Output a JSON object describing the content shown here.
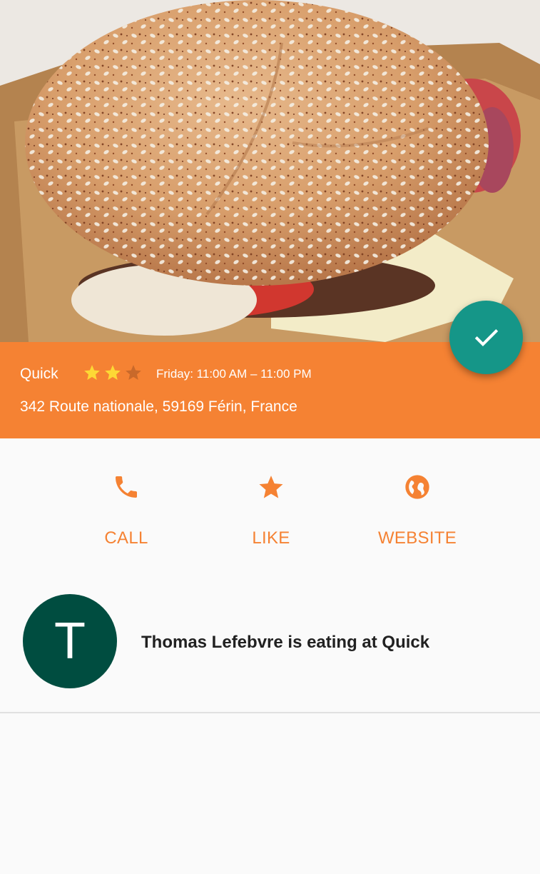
{
  "hero": {
    "image_alt": "Burger photo"
  },
  "place": {
    "name": "Quick",
    "rating": {
      "filled": 2,
      "total": 3
    },
    "hours": "Friday: 11:00 AM – 11:00 PM",
    "address": "342 Route nationale, 59169 Férin, France"
  },
  "actions": [
    {
      "label": "CALL",
      "icon": "phone-icon"
    },
    {
      "label": "LIKE",
      "icon": "star-icon"
    },
    {
      "label": "WEBSITE",
      "icon": "globe-icon"
    }
  ],
  "feed": {
    "avatar_letter": "T",
    "text": "Thomas Lefebvre is eating at Quick"
  },
  "colors": {
    "accent": "#f58233",
    "fab": "#159688",
    "avatar": "#004d40",
    "star_filled": "#fdd835",
    "star_empty": "#c9692a"
  }
}
